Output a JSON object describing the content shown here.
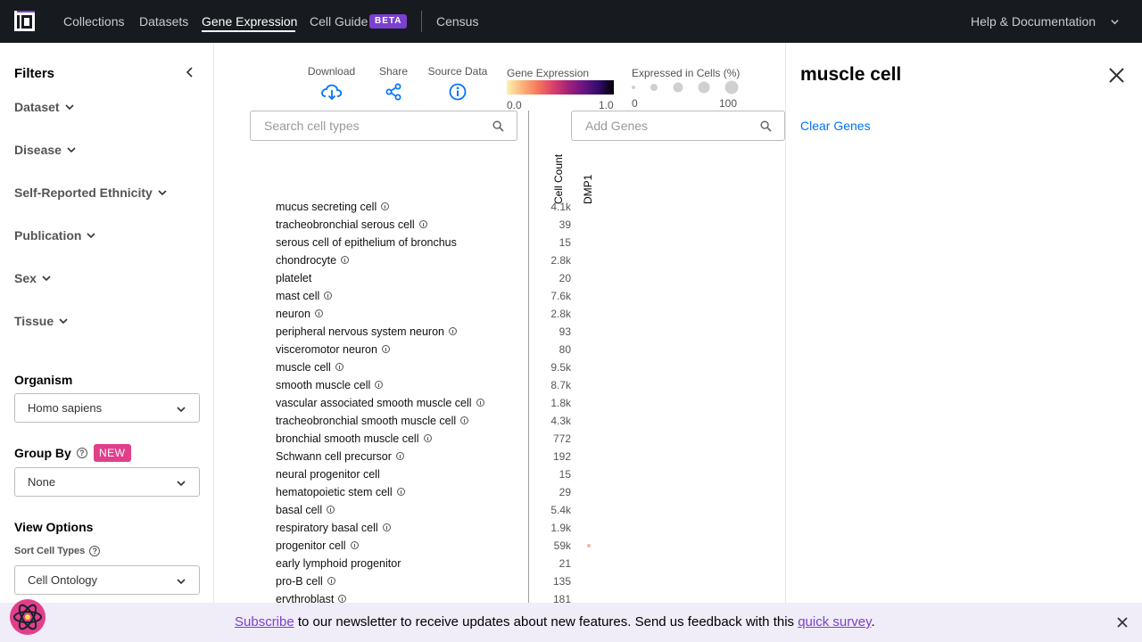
{
  "nav": {
    "links": [
      "Collections",
      "Datasets",
      "Gene Expression",
      "Cell Guide",
      "Census"
    ],
    "beta": "BETA",
    "help": "Help & Documentation"
  },
  "sidebar": {
    "filters_title": "Filters",
    "filters": [
      "Dataset",
      "Disease",
      "Self-Reported Ethnicity",
      "Publication",
      "Sex",
      "Tissue"
    ],
    "organism_label": "Organism",
    "organism_value": "Homo sapiens",
    "group_by_label": "Group By",
    "group_by_badge": "NEW",
    "group_by_value": "None",
    "view_options_label": "View Options",
    "sort_label": "Sort Cell Types",
    "sort_value": "Cell Ontology"
  },
  "toolbar": {
    "download": "Download",
    "share": "Share",
    "source_data": "Source Data",
    "gene_expression_label": "Gene Expression",
    "ge_min": "0.0",
    "ge_max": "1.0",
    "expressed_label": "Expressed in Cells (%)",
    "ex_min": "0",
    "ex_max": "100"
  },
  "search": {
    "cell_types_placeholder": "Search cell types",
    "genes_placeholder": "Add Genes"
  },
  "columns": {
    "cell_count": "Cell Count",
    "gene": "DMP1"
  },
  "rows": [
    {
      "label": "mucus secreting cell",
      "info": true,
      "count": "4.1k"
    },
    {
      "label": "tracheobronchial serous cell",
      "info": true,
      "count": "39"
    },
    {
      "label": "serous cell of epithelium of bronchus",
      "info": false,
      "count": "15"
    },
    {
      "label": "chondrocyte",
      "info": true,
      "count": "2.8k"
    },
    {
      "label": "platelet",
      "info": false,
      "count": "20"
    },
    {
      "label": "mast cell",
      "info": true,
      "count": "7.6k"
    },
    {
      "label": "neuron",
      "info": true,
      "count": "2.8k"
    },
    {
      "label": "peripheral nervous system neuron",
      "info": true,
      "count": "93"
    },
    {
      "label": "visceromotor neuron",
      "info": true,
      "count": "80"
    },
    {
      "label": "muscle cell",
      "info": true,
      "count": "9.5k"
    },
    {
      "label": "smooth muscle cell",
      "info": true,
      "count": "8.7k"
    },
    {
      "label": "vascular associated smooth muscle cell",
      "info": true,
      "count": "1.8k"
    },
    {
      "label": "tracheobronchial smooth muscle cell",
      "info": true,
      "count": "4.3k"
    },
    {
      "label": "bronchial smooth muscle cell",
      "info": true,
      "count": "772"
    },
    {
      "label": "Schwann cell precursor",
      "info": true,
      "count": "192"
    },
    {
      "label": "neural progenitor cell",
      "info": false,
      "count": "15"
    },
    {
      "label": "hematopoietic stem cell",
      "info": true,
      "count": "29"
    },
    {
      "label": "basal cell",
      "info": true,
      "count": "5.4k"
    },
    {
      "label": "respiratory basal cell",
      "info": true,
      "count": "1.9k"
    },
    {
      "label": "progenitor cell",
      "info": true,
      "count": "59k"
    },
    {
      "label": "early lymphoid progenitor",
      "info": false,
      "count": "21"
    },
    {
      "label": "pro-B cell",
      "info": true,
      "count": "135"
    },
    {
      "label": "erythroblast",
      "info": true,
      "count": "181"
    }
  ],
  "panel": {
    "title": "muscle cell",
    "clear_genes": "Clear Genes"
  },
  "banner": {
    "subscribe": "Subscribe",
    "middle": " to our newsletter to receive updates about new features. Send us feedback with this ",
    "survey": "quick survey",
    "end": "."
  },
  "colors": {
    "nav_bg": "#171a1f",
    "link_blue": "#0073ff",
    "beta_purple": "#7a41ce",
    "new_pink": "#e23f8b"
  }
}
